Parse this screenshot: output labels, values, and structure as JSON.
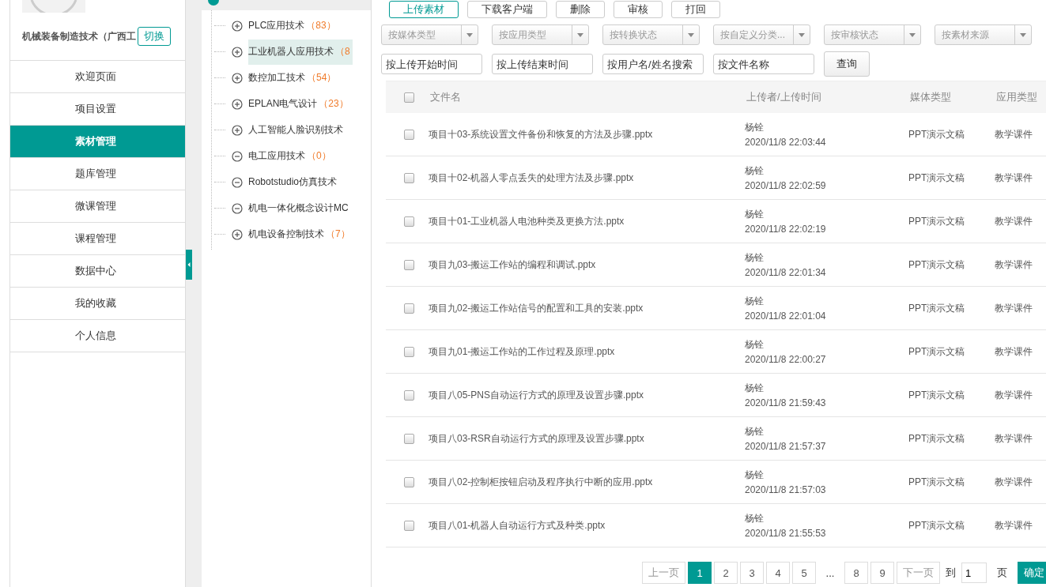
{
  "sidebar": {
    "org_name": "机械装备制造技术（广西工",
    "switch_button": "切换",
    "items": [
      {
        "label": "欢迎页面",
        "selected": false
      },
      {
        "label": "项目设置",
        "selected": false
      },
      {
        "label": "素材管理",
        "selected": true
      },
      {
        "label": "题库管理",
        "selected": false
      },
      {
        "label": "微课管理",
        "selected": false
      },
      {
        "label": "课程管理",
        "selected": false
      },
      {
        "label": "数据中心",
        "selected": false
      },
      {
        "label": "我的收藏",
        "selected": false
      },
      {
        "label": "个人信息",
        "selected": false
      }
    ]
  },
  "tree": {
    "items": [
      {
        "label": "PLC应用技术",
        "count": "（83）",
        "expanded": false,
        "selected": false
      },
      {
        "label": "工业机器人应用技术",
        "count": "（8",
        "expanded": false,
        "selected": true
      },
      {
        "label": "数控加工技术",
        "count": "（54）",
        "expanded": false,
        "selected": false
      },
      {
        "label": "EPLAN电气设计",
        "count": "（23）",
        "expanded": false,
        "selected": false
      },
      {
        "label": "人工智能人脸识别技术",
        "expanded": false,
        "selected": false
      },
      {
        "label": "电工应用技术",
        "count": "（0）",
        "expanded": true,
        "selected": false
      },
      {
        "label": "Robotstudio仿真技术",
        "expanded": true,
        "selected": false
      },
      {
        "label": "机电一体化概念设计MC",
        "expanded": true,
        "selected": false
      },
      {
        "label": "机电设备控制技术",
        "count": "（7）",
        "expanded": false,
        "selected": false
      }
    ]
  },
  "toolbar": [
    {
      "label": "上传素材",
      "primary": true
    },
    {
      "label": "下载客户端",
      "primary": false
    },
    {
      "label": "删除",
      "primary": false
    },
    {
      "label": "审核",
      "primary": false
    },
    {
      "label": "打回",
      "primary": false
    }
  ],
  "filters": {
    "selects": [
      {
        "placeholder": "按媒体类型"
      },
      {
        "placeholder": "按应用类型"
      },
      {
        "placeholder": "按转换状态"
      },
      {
        "placeholder": "按自定义分类..."
      },
      {
        "placeholder": "按审核状态"
      },
      {
        "placeholder": "按素材来源"
      }
    ],
    "inputs": [
      {
        "placeholder": "按上传开始时间"
      },
      {
        "placeholder": "按上传结束时间"
      },
      {
        "placeholder": "按用户名/姓名搜索"
      },
      {
        "placeholder": "按文件名称"
      }
    ],
    "query_button": "查询"
  },
  "table": {
    "select_all_checked": false,
    "columns": [
      "文件名",
      "上传者/上传时间",
      "媒体类型",
      "应用类型"
    ],
    "rows": [
      {
        "checked": false,
        "file": "项目十03-系统设置文件备份和恢复的方法及步骤.pptx",
        "uploader": "杨铨",
        "time": "2020/11/8 22:03:44",
        "media_type": "PPT演示文稿",
        "app_type": "教学课件"
      },
      {
        "checked": false,
        "file": "项目十02-机器人零点丢失的处理方法及步骤.pptx",
        "uploader": "杨铨",
        "time": "2020/11/8 22:02:59",
        "media_type": "PPT演示文稿",
        "app_type": "教学课件"
      },
      {
        "checked": false,
        "file": "项目十01-工业机器人电池种类及更换方法.pptx",
        "uploader": "杨铨",
        "time": "2020/11/8 22:02:19",
        "media_type": "PPT演示文稿",
        "app_type": "教学课件"
      },
      {
        "checked": false,
        "file": "项目九03-搬运工作站的编程和调试.pptx",
        "uploader": "杨铨",
        "time": "2020/11/8 22:01:34",
        "media_type": "PPT演示文稿",
        "app_type": "教学课件"
      },
      {
        "checked": false,
        "file": "项目九02-搬运工作站信号的配置和工具的安装.pptx",
        "uploader": "杨铨",
        "time": "2020/11/8 22:01:04",
        "media_type": "PPT演示文稿",
        "app_type": "教学课件"
      },
      {
        "checked": false,
        "file": "项目九01-搬运工作站的工作过程及原理.pptx",
        "uploader": "杨铨",
        "time": "2020/11/8 22:00:27",
        "media_type": "PPT演示文稿",
        "app_type": "教学课件"
      },
      {
        "checked": false,
        "file": "项目八05-PNS自动运行方式的原理及设置步骤.pptx",
        "uploader": "杨铨",
        "time": "2020/11/8 21:59:43",
        "media_type": "PPT演示文稿",
        "app_type": "教学课件"
      },
      {
        "checked": false,
        "file": "项目八03-RSR自动运行方式的原理及设置步骤.pptx",
        "uploader": "杨铨",
        "time": "2020/11/8 21:57:37",
        "media_type": "PPT演示文稿",
        "app_type": "教学课件"
      },
      {
        "checked": false,
        "file": "项目八02-控制柜按钮启动及程序执行中断的应用.pptx",
        "uploader": "杨铨",
        "time": "2020/11/8 21:57:03",
        "media_type": "PPT演示文稿",
        "app_type": "教学课件"
      },
      {
        "checked": false,
        "file": "项目八01-机器人自动运行方式及种类.pptx",
        "uploader": "杨铨",
        "time": "2020/11/8 21:55:53",
        "media_type": "PPT演示文稿",
        "app_type": "教学课件"
      }
    ]
  },
  "pagination": {
    "prev": "上一页",
    "pages": [
      {
        "kind": "page",
        "label": "1",
        "selected": true
      },
      {
        "kind": "page",
        "label": "2",
        "selected": false
      },
      {
        "kind": "page",
        "label": "3",
        "selected": false
      },
      {
        "kind": "page",
        "label": "4",
        "selected": false
      },
      {
        "kind": "page",
        "label": "5",
        "selected": false
      },
      {
        "kind": "ellipsis",
        "label": "..."
      },
      {
        "kind": "page",
        "label": "8",
        "selected": false
      },
      {
        "kind": "page",
        "label": "9",
        "selected": false
      }
    ],
    "next": "下一页",
    "goto_label": "到",
    "page_input": "1",
    "page_unit": "页",
    "confirm": "确定"
  }
}
